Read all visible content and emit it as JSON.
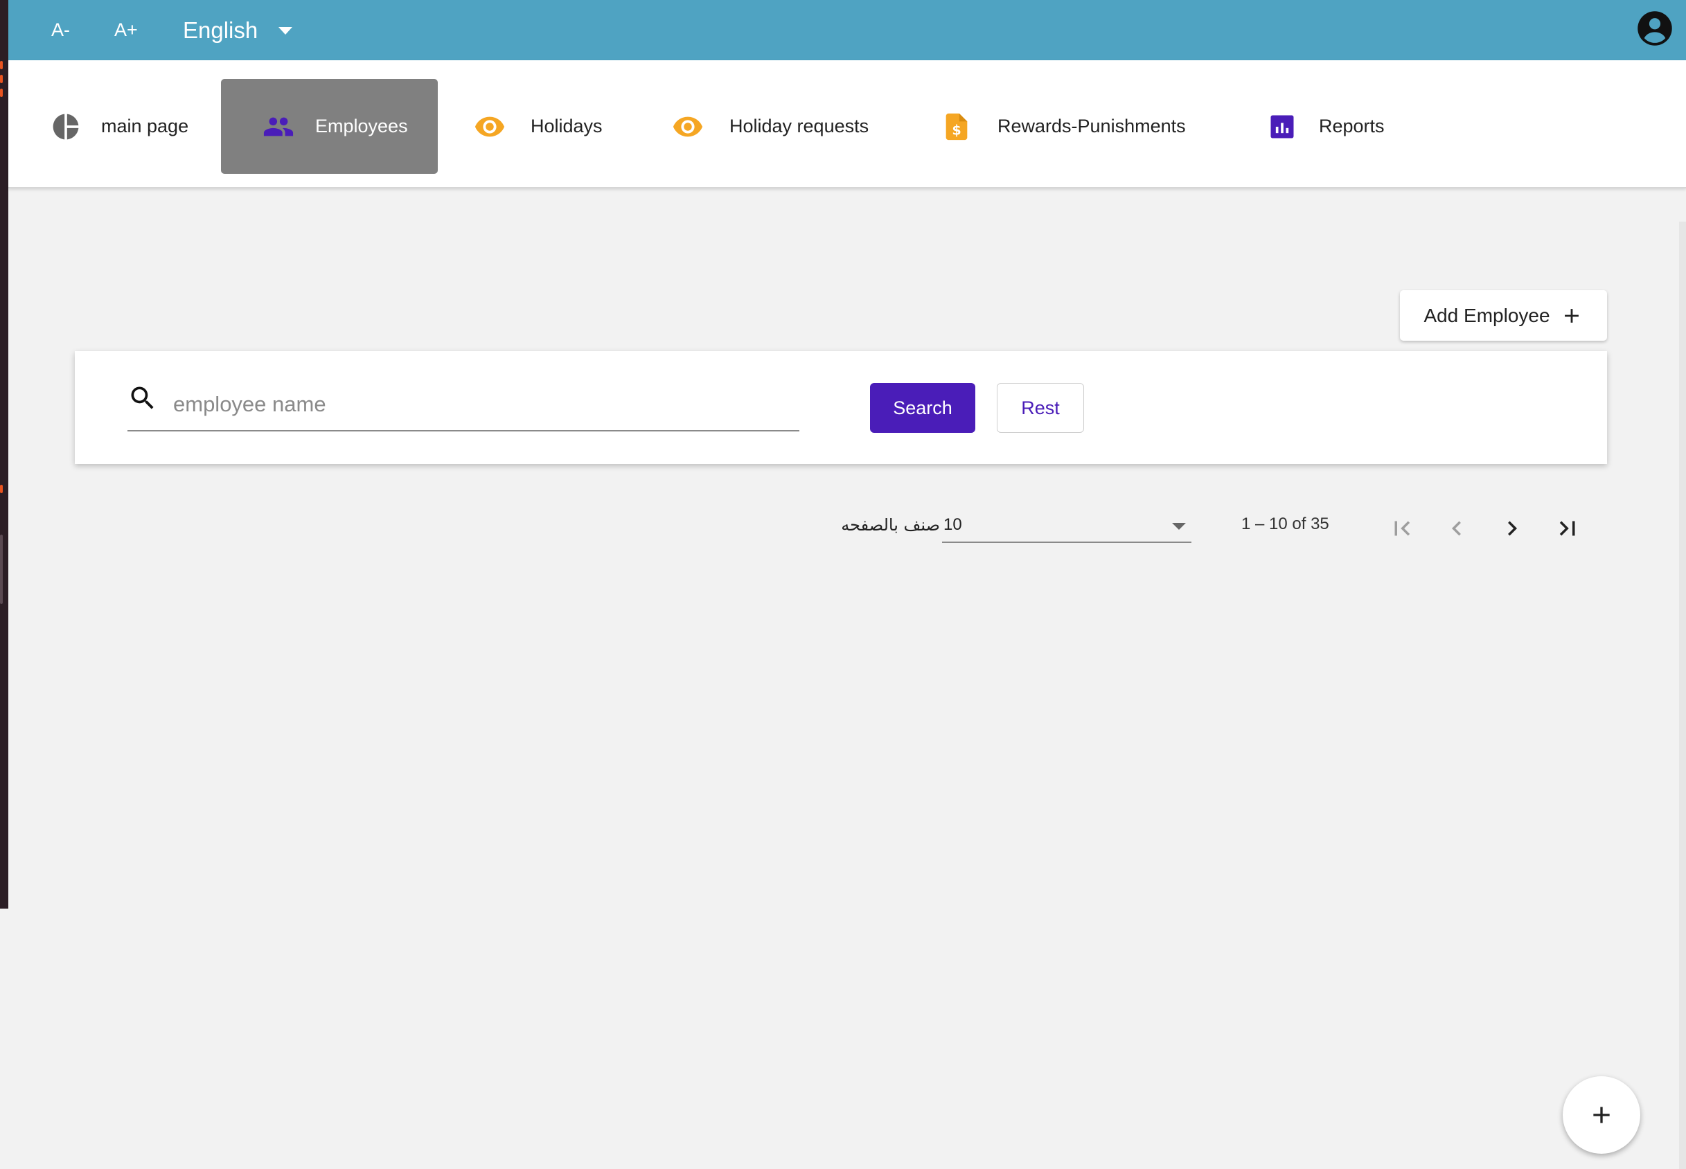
{
  "topbar": {
    "font_decrease": "A-",
    "font_increase": "A+",
    "language": "English",
    "color": "#4fa3c2"
  },
  "nav": {
    "items": [
      {
        "label": "main page",
        "icon": "pie-chart-icon"
      },
      {
        "label": "Employees",
        "icon": "people-icon",
        "active": true
      },
      {
        "label": "Holidays",
        "icon": "eye-icon"
      },
      {
        "label": "Holiday requests",
        "icon": "eye-icon"
      },
      {
        "label": "Rewards-Punishments",
        "icon": "money-document-icon"
      },
      {
        "label": "Reports",
        "icon": "bar-chart-icon"
      }
    ]
  },
  "actions": {
    "add_employee": "Add Employee"
  },
  "search": {
    "placeholder": "employee name",
    "value": "",
    "search_label": "Search",
    "reset_label": "Rest"
  },
  "paginator": {
    "items_per_page_label": "صنف بالصفحه",
    "page_size": "10",
    "range_label": "1 – 10 of 35"
  },
  "colors": {
    "primary": "#4a1db8",
    "accent_orange": "#f5a623",
    "active_tab": "#808080"
  }
}
